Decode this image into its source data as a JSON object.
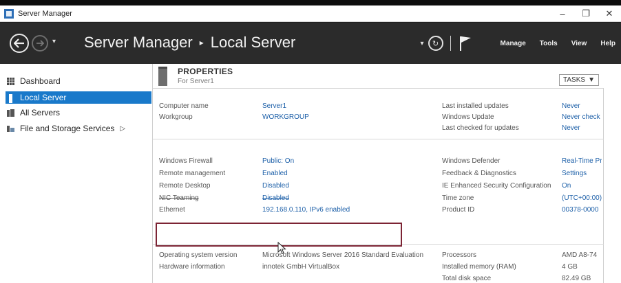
{
  "window": {
    "title": "Server Manager",
    "controls": {
      "minimize": "–",
      "maximize": "❐",
      "close": "✕"
    }
  },
  "header": {
    "breadcrumb_app": "Server Manager",
    "breadcrumb_sep": "▸",
    "breadcrumb_page": "Local Server",
    "menus": [
      "Manage",
      "Tools",
      "View",
      "Help"
    ]
  },
  "sidebar": {
    "items": [
      {
        "label": "Dashboard",
        "icon": "dashboard-icon"
      },
      {
        "label": "Local Server",
        "icon": "server-icon",
        "active": true
      },
      {
        "label": "All Servers",
        "icon": "servers-icon"
      },
      {
        "label": "File and Storage Services",
        "icon": "storage-icon",
        "chevron": "▷"
      }
    ]
  },
  "properties": {
    "title": "PROPERTIES",
    "subtitle": "For Server1",
    "tasks_label": "TASKS",
    "tasks_arrow": "▼",
    "left": [
      {
        "label": "Computer name",
        "value": "Server1"
      },
      {
        "label": "Workgroup",
        "value": "WORKGROUP"
      },
      {
        "label": "Windows Firewall",
        "value": "Public: On"
      },
      {
        "label": "Remote management",
        "value": "Enabled"
      },
      {
        "label": "Remote Desktop",
        "value": "Disabled"
      },
      {
        "label": "NIC Teaming",
        "value": "Disabled"
      },
      {
        "label": "Ethernet",
        "value": "192.168.0.110, IPv6 enabled"
      },
      {
        "label": "Operating system version",
        "value": "Microsoft Windows Server 2016 Standard Evaluation"
      },
      {
        "label": "Hardware information",
        "value": "innotek GmbH VirtualBox"
      }
    ],
    "right": [
      {
        "label": "Last installed updates",
        "value": "Never"
      },
      {
        "label": "Windows Update",
        "value": "Never check"
      },
      {
        "label": "Last checked for updates",
        "value": "Never"
      },
      {
        "label": "Windows Defender",
        "value": "Real-Time Pr"
      },
      {
        "label": "Feedback & Diagnostics",
        "value": "Settings"
      },
      {
        "label": "IE Enhanced Security Configuration",
        "value": "On"
      },
      {
        "label": "Time zone",
        "value": "(UTC+00:00)"
      },
      {
        "label": "Product ID",
        "value": "00378-0000"
      },
      {
        "label": "Processors",
        "value": "AMD A8-74"
      },
      {
        "label": "Installed memory (RAM)",
        "value": "4 GB"
      },
      {
        "label": "Total disk space",
        "value": "82.49 GB"
      }
    ]
  },
  "colors": {
    "header_bg": "#2b2b2b",
    "accent": "#1979ca",
    "link": "#1c5fa8",
    "highlight_border": "#7c2434"
  }
}
